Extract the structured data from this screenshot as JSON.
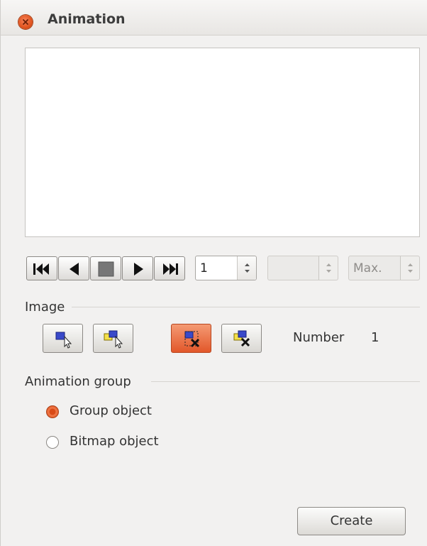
{
  "window": {
    "title": "Animation"
  },
  "playback": {
    "first_icon": "skip-to-first-icon",
    "back_icon": "play-backward-icon",
    "stop_icon": "stop-icon",
    "play_icon": "play-icon",
    "last_icon": "skip-to-last-icon",
    "frame_value": "1",
    "duration_value": "",
    "loop_value": "Max."
  },
  "image_section": {
    "label": "Image",
    "buttons": [
      {
        "icon": "apply-object-icon"
      },
      {
        "icon": "apply-objects-individually-icon"
      },
      {
        "icon": "delete-current-image-icon",
        "active": true
      },
      {
        "icon": "delete-all-images-icon"
      }
    ],
    "number_label": "Number",
    "number_value": "1"
  },
  "animation_group": {
    "label": "Animation group",
    "options": [
      {
        "label": "Group object",
        "checked": true
      },
      {
        "label": "Bitmap object",
        "checked": false
      }
    ]
  },
  "footer": {
    "create_label": "Create"
  },
  "colors": {
    "accent": "#e0541f",
    "background": "#f2f1f0"
  }
}
